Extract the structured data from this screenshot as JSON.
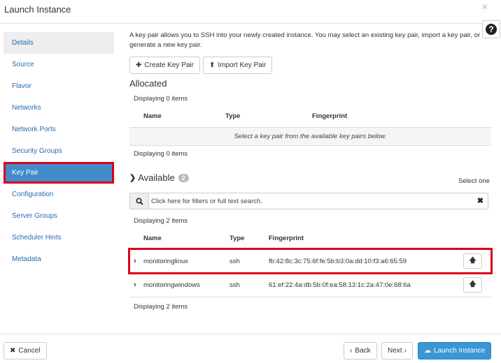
{
  "modal": {
    "title": "Launch Instance",
    "close": "×",
    "help": "?"
  },
  "sidebar": {
    "items": [
      {
        "label": "Details"
      },
      {
        "label": "Source"
      },
      {
        "label": "Flavor"
      },
      {
        "label": "Networks"
      },
      {
        "label": "Network Ports"
      },
      {
        "label": "Security Groups"
      },
      {
        "label": "Key Pair"
      },
      {
        "label": "Configuration"
      },
      {
        "label": "Server Groups"
      },
      {
        "label": "Scheduler Hints"
      },
      {
        "label": "Metadata"
      }
    ]
  },
  "main": {
    "intro": "A key pair allows you to SSH into your newly created instance. You may select an existing key pair, import a key pair, or generate a new key pair.",
    "create_btn": "Create Key Pair",
    "import_btn": "Import Key Pair",
    "allocated": {
      "title": "Allocated",
      "count_top": "Displaying 0 items",
      "columns": [
        "Name",
        "Type",
        "Fingerprint"
      ],
      "empty_message": "Select a key pair from the available key pairs below.",
      "count_bottom": "Displaying 0 items"
    },
    "available": {
      "title": "Available",
      "badge": "2",
      "select_hint": "Select one",
      "search_placeholder": "Click here for filters or full text search.",
      "count_top": "Displaying 2 items",
      "columns": [
        "Name",
        "Type",
        "Fingerprint"
      ],
      "rows": [
        {
          "name": "monitoringlinux",
          "type": "ssh",
          "fingerprint": "fb:42:8c:3c:75:6f:fe:5b:b3:0a:dd:10:f3:a6:65:59"
        },
        {
          "name": "monitoringwindows",
          "type": "ssh",
          "fingerprint": "61:ef:22:4a:db:5b:0f:ea:58:13:1c:2a:47:0e:68:6a"
        }
      ],
      "count_bottom": "Displaying 2 items"
    }
  },
  "footer": {
    "cancel": "Cancel",
    "back": "Back",
    "next": "Next",
    "launch": "Launch Instance"
  },
  "colors": {
    "accent": "#428bca",
    "highlight": "#d9001a",
    "primary_button": "#3a96d6",
    "link": "#2a6aae"
  }
}
